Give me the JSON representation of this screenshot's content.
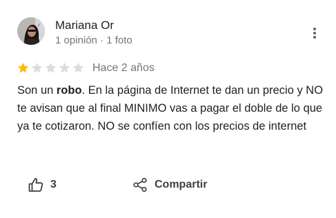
{
  "review": {
    "author": {
      "name": "Mariana Or",
      "meta": "1 opinión · 1 foto",
      "avatar_icon": "profile-photo"
    },
    "rating": {
      "value": 1,
      "max": 5,
      "filled_color": "#fbbc04",
      "empty_color": "#dadce0"
    },
    "time_ago": "Hace 2 años",
    "text": {
      "part1": "Son un ",
      "bold": "robo",
      "part2": ". En la página de Internet te dan un precio y NO te avisan que al final MINIMO vas a pagar el doble de lo que ya te cotizaron.  NO se confíen con los precios de internet"
    },
    "actions": {
      "like_count": "3",
      "share_label": "Compartir"
    }
  }
}
